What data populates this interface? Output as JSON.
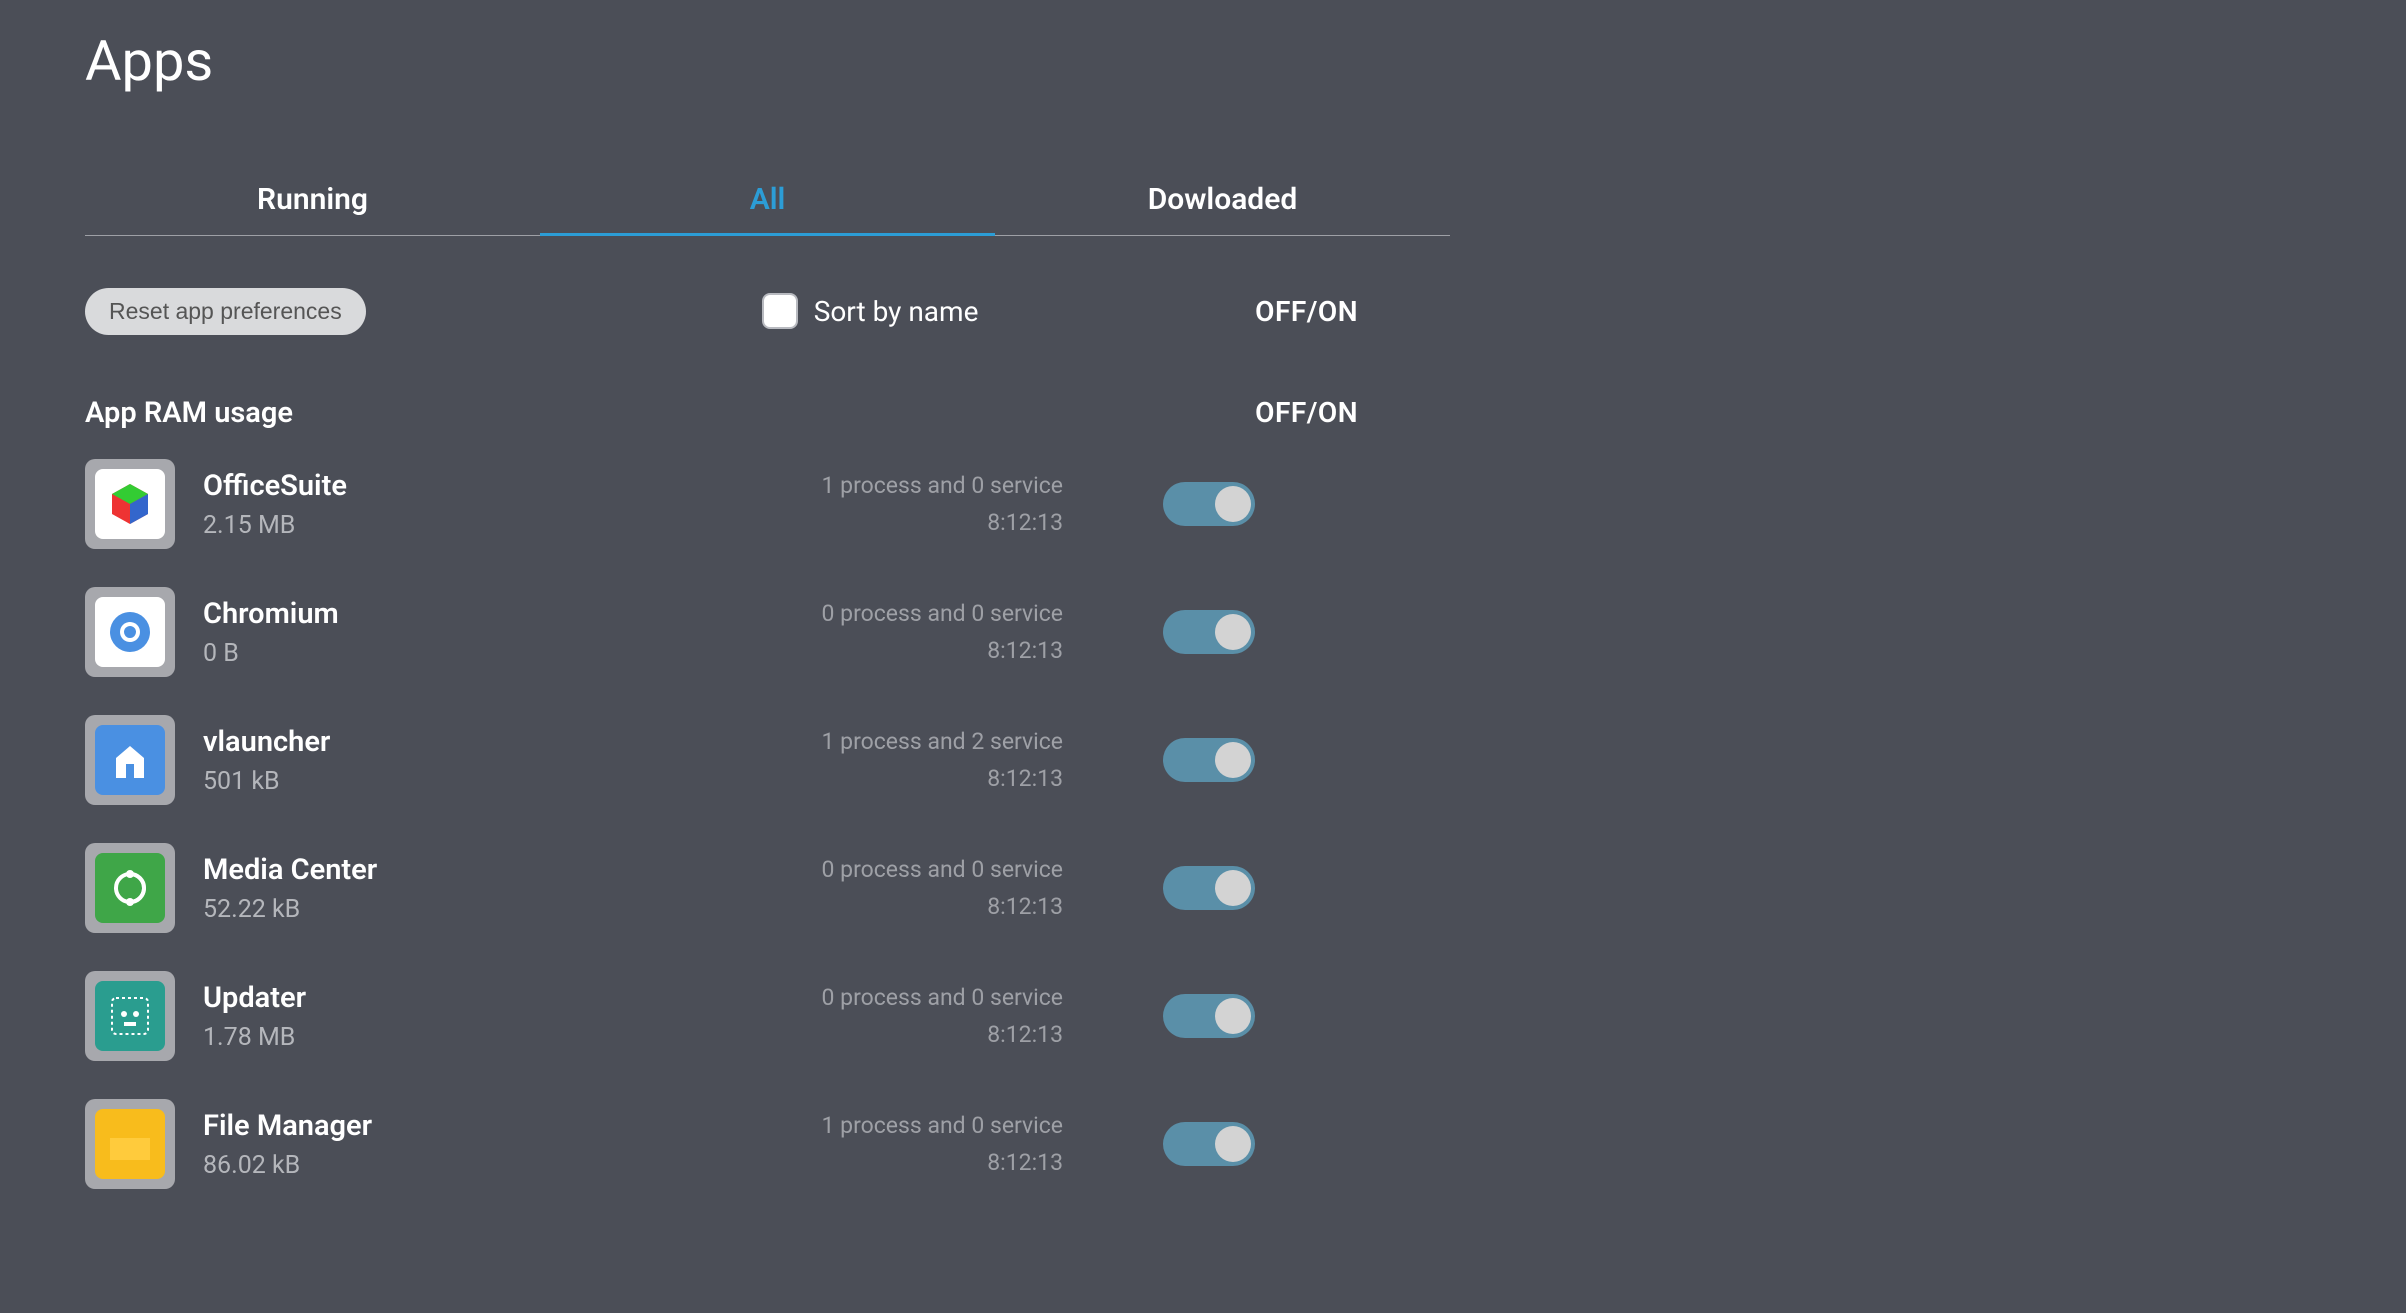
{
  "title": "Apps",
  "tabs": [
    {
      "label": "Running"
    },
    {
      "label": "All"
    },
    {
      "label": "Dowloaded"
    }
  ],
  "active_tab_index": 1,
  "reset_button_label": "Reset app preferences",
  "sort_label": "Sort by name",
  "offon_label": "OFF/ON",
  "ram_section_title": "App RAM usage",
  "apps": [
    {
      "name": "OfficeSuite",
      "size": "2.15 MB",
      "process_info": "1 process and 0 service",
      "time": "8:12:13",
      "icon": "office"
    },
    {
      "name": "Chromium",
      "size": "0 B",
      "process_info": "0 process and 0 service",
      "time": "8:12:13",
      "icon": "chromium"
    },
    {
      "name": "vlauncher",
      "size": "501 kB",
      "process_info": "1 process and 2 service",
      "time": "8:12:13",
      "icon": "vlauncher"
    },
    {
      "name": "Media Center",
      "size": "52.22 kB",
      "process_info": "0 process and 0 service",
      "time": "8:12:13",
      "icon": "media"
    },
    {
      "name": "Updater",
      "size": "1.78 MB",
      "process_info": "0 process and 0 service",
      "time": "8:12:13",
      "icon": "updater"
    },
    {
      "name": "File Manager",
      "size": "86.02 kB",
      "process_info": "1 process and 0 service",
      "time": "8:12:13",
      "icon": "file"
    }
  ]
}
